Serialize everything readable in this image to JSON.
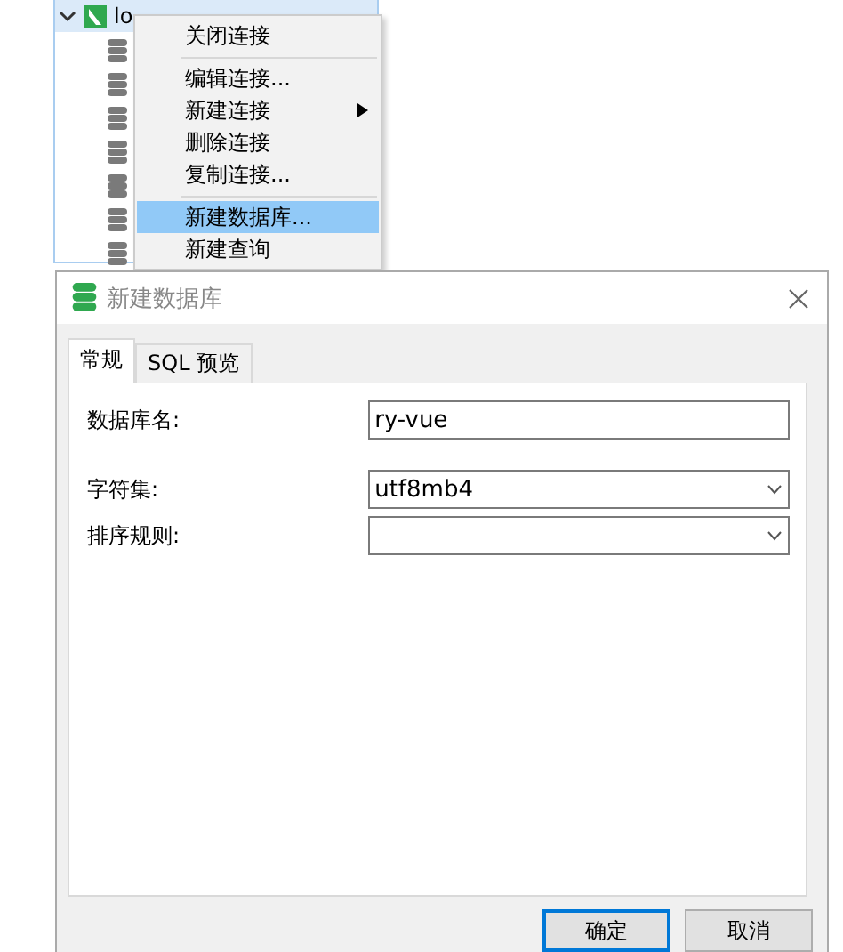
{
  "tree": {
    "node": {
      "label": "lo",
      "expanded": true
    },
    "children": [
      {
        "kind": "database"
      },
      {
        "kind": "database"
      },
      {
        "kind": "database"
      },
      {
        "kind": "database"
      },
      {
        "kind": "database"
      },
      {
        "kind": "database"
      },
      {
        "kind": "database"
      }
    ]
  },
  "context_menu": {
    "groups": [
      [
        {
          "label": "关闭连接",
          "selected": false,
          "submenu": false
        }
      ],
      [
        {
          "label": "编辑连接...",
          "selected": false,
          "submenu": false
        },
        {
          "label": "新建连接",
          "selected": false,
          "submenu": true
        },
        {
          "label": "删除连接",
          "selected": false,
          "submenu": false
        },
        {
          "label": "复制连接...",
          "selected": false,
          "submenu": false
        }
      ],
      [
        {
          "label": "新建数据库...",
          "selected": true,
          "submenu": false
        },
        {
          "label": "新建查询",
          "selected": false,
          "submenu": false
        }
      ]
    ]
  },
  "dialog": {
    "title": "新建数据库",
    "tabs": [
      {
        "label": "常规",
        "selected": true
      },
      {
        "label": "SQL 预览",
        "selected": false
      }
    ],
    "fields": [
      {
        "label": "数据库名:",
        "kind": "text",
        "value": "ry-vue"
      },
      {
        "label": "字符集:",
        "kind": "select",
        "value": "utf8mb4"
      },
      {
        "label": "排序规则:",
        "kind": "select"
      }
    ],
    "buttons": [
      {
        "label": "确定",
        "default": true
      },
      {
        "label": "取消",
        "default": false
      }
    ]
  }
}
